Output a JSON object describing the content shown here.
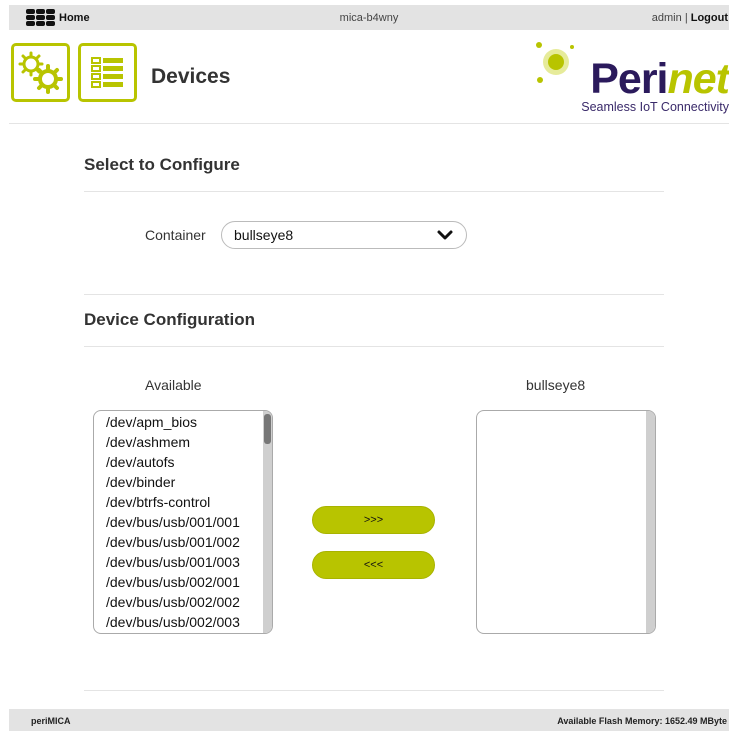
{
  "topbar": {
    "home_label": "Home",
    "hostname": "mica-b4wny",
    "user": "admin",
    "separator": "|",
    "logout_label": "Logout"
  },
  "header": {
    "page_title": "Devices",
    "logo": {
      "brand_main": "Peri",
      "brand_accent": "net",
      "tagline": "Seamless IoT Connectivity"
    },
    "tile_icons": [
      "gears-icon",
      "list-icon"
    ]
  },
  "select_section": {
    "title": "Select to Configure",
    "container_label": "Container",
    "container_value": "bullseye8"
  },
  "device_section": {
    "title": "Device Configuration",
    "available_label": "Available",
    "assigned_label": "bullseye8",
    "available_devices": [
      "/dev/apm_bios",
      "/dev/ashmem",
      "/dev/autofs",
      "/dev/binder",
      "/dev/btrfs-control",
      "/dev/bus/usb/001/001",
      "/dev/bus/usb/001/002",
      "/dev/bus/usb/001/003",
      "/dev/bus/usb/002/001",
      "/dev/bus/usb/002/002",
      "/dev/bus/usb/002/003"
    ],
    "assigned_devices": [],
    "add_button": ">>>",
    "remove_button": "<<<"
  },
  "footer": {
    "app_name": "periMICA",
    "flash_memory": "Available Flash Memory: 1652.49 MByte"
  },
  "colors": {
    "accent": "#b8c400",
    "brand_dark": "#2b1a5c",
    "bar_gray": "#e3e3e3"
  }
}
